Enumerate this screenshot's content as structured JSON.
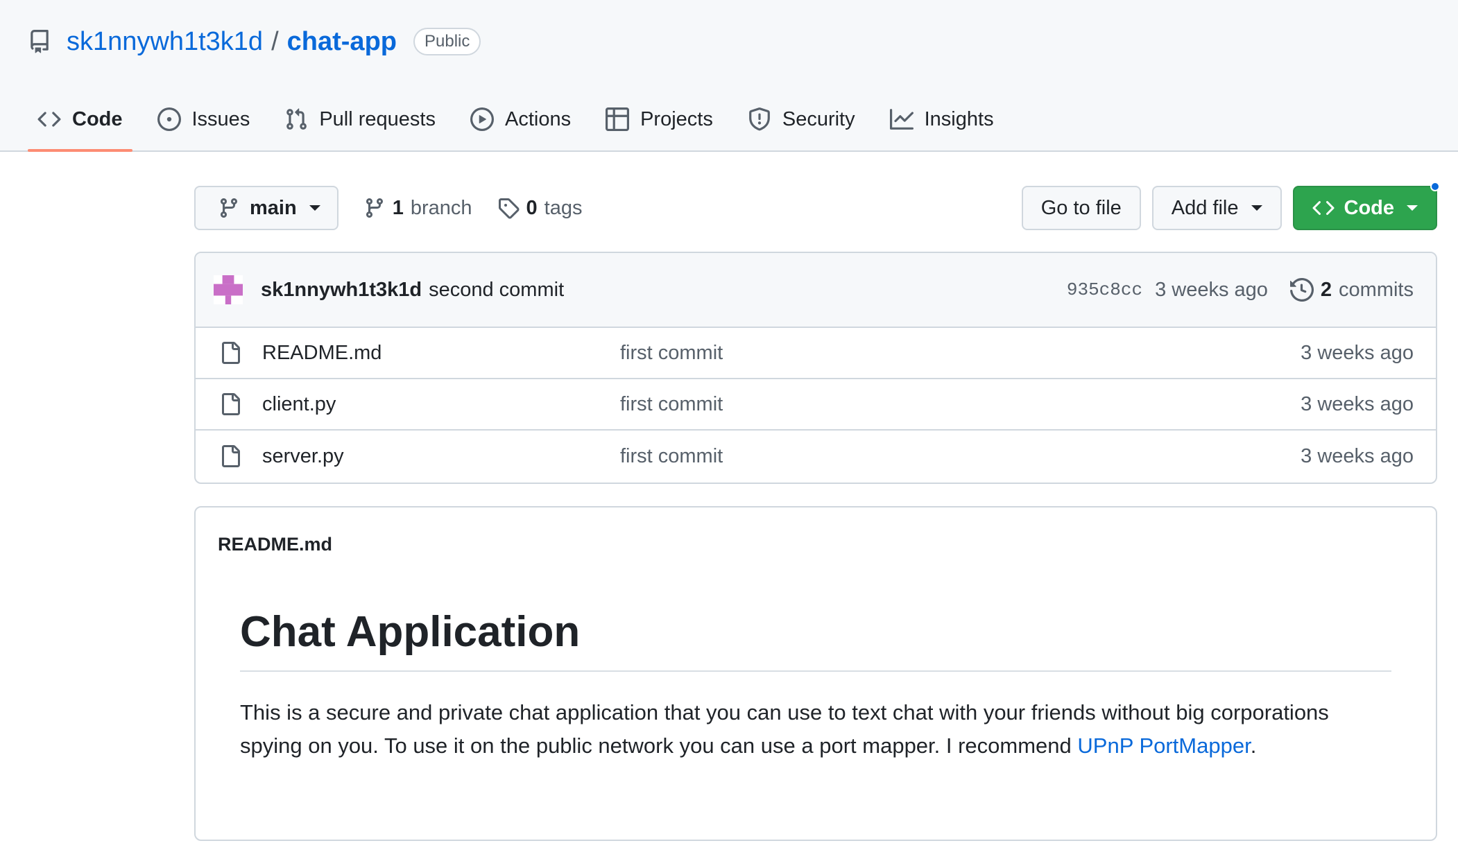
{
  "repo": {
    "owner": "sk1nnywh1t3k1d",
    "separator": "/",
    "name": "chat-app",
    "visibility": "Public"
  },
  "tabs": [
    {
      "label": "Code",
      "icon": "code-icon",
      "active": true
    },
    {
      "label": "Issues",
      "icon": "issue-icon"
    },
    {
      "label": "Pull requests",
      "icon": "pull-request-icon"
    },
    {
      "label": "Actions",
      "icon": "play-icon"
    },
    {
      "label": "Projects",
      "icon": "table-icon"
    },
    {
      "label": "Security",
      "icon": "shield-icon"
    },
    {
      "label": "Insights",
      "icon": "graph-icon"
    }
  ],
  "toolbar": {
    "branch": "main",
    "branch_count": "1",
    "branch_label": "branch",
    "tag_count": "0",
    "tag_label": "tags",
    "go_to_file": "Go to file",
    "add_file": "Add file",
    "code": "Code"
  },
  "latest_commit": {
    "author": "sk1nnywh1t3k1d",
    "message": "second commit",
    "sha": "935c8cc",
    "ago": "3 weeks ago",
    "count": "2",
    "count_label": "commits"
  },
  "files": [
    {
      "name": "README.md",
      "commit": "first commit",
      "ago": "3 weeks ago"
    },
    {
      "name": "client.py",
      "commit": "first commit",
      "ago": "3 weeks ago"
    },
    {
      "name": "server.py",
      "commit": "first commit",
      "ago": "3 weeks ago"
    }
  ],
  "readme": {
    "filename": "README.md",
    "heading": "Chat Application",
    "paragraph": "This is a secure and private chat application that you can use to text chat with your friends without big corporations spying on you. To use it on the public network you can use a port mapper. I recommend ",
    "link_text": "UPnP PortMapper",
    "paragraph_end": "."
  },
  "colors": {
    "accent": "#0969da",
    "code_button": "#2da44e",
    "tab_underline": "#fd8c73",
    "avatar": "#c96fc7"
  }
}
